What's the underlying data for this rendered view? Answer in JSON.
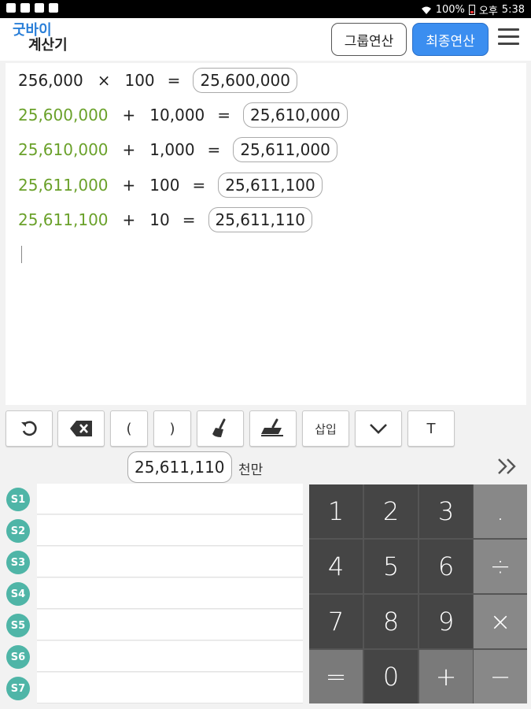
{
  "status_bar": {
    "battery": "100%",
    "ampm": "오후",
    "time": "5:38"
  },
  "header": {
    "logo_line1": "굿바이",
    "logo_line2": "계산기",
    "group_button": "그룹연산",
    "final_button": "최종연산"
  },
  "calc_lines": [
    {
      "lhs": "256,000",
      "op": "×",
      "rhs": "100",
      "eq": "=",
      "result": "25,600,000"
    },
    {
      "lhs": "25,600,000",
      "op": "+",
      "rhs": "10,000",
      "eq": "=",
      "result": "25,610,000"
    },
    {
      "lhs": "25,610,000",
      "op": "+",
      "rhs": "1,000",
      "eq": "=",
      "result": "25,611,000"
    },
    {
      "lhs": "25,611,000",
      "op": "+",
      "rhs": "100",
      "eq": "=",
      "result": "25,611,100"
    },
    {
      "lhs": "25,611,100",
      "op": "+",
      "rhs": "10",
      "eq": "=",
      "result": "25,611,110"
    }
  ],
  "toolbar": {
    "open_paren": "(",
    "close_paren": ")",
    "insert": "삽입",
    "text": "T"
  },
  "result": {
    "value": "25,611,110",
    "unit": "천만"
  },
  "memory_slots": [
    "S1",
    "S2",
    "S3",
    "S4",
    "S5",
    "S6",
    "S7"
  ],
  "keypad": {
    "k1": "1",
    "k2": "2",
    "k3": "3",
    "dot": ".",
    "k4": "4",
    "k5": "5",
    "k6": "6",
    "div": "÷",
    "k7": "7",
    "k8": "8",
    "k9": "9",
    "mul": "×",
    "eq": "=",
    "k0": "0",
    "plus": "+",
    "minus": "−"
  },
  "colors": {
    "accent_blue": "#3b8ef0",
    "logo_blue": "#2a7fd8",
    "continued_green": "#6aa12a",
    "memory_badge": "#4fb5a7"
  }
}
